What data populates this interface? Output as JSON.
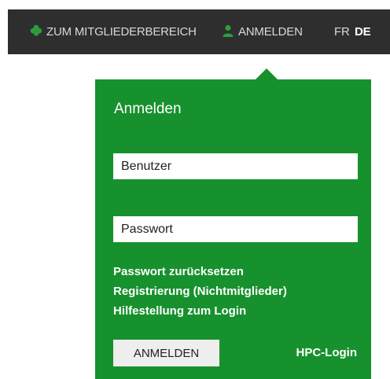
{
  "topbar": {
    "members_label": "ZUM MITGLIEDERBEREICH",
    "members_icon": "clover-icon",
    "login_label": "ANMELDEN",
    "login_icon": "user-icon",
    "lang_fr": "FR",
    "lang_de": "DE",
    "active_language": "DE",
    "icon_color": "#2e9e3a"
  },
  "login_panel": {
    "title": "Anmelden",
    "username_placeholder": "Benutzer",
    "password_placeholder": "Passwort",
    "links": [
      "Passwort zurücksetzen",
      "Registrierung (Nichtmitglieder)",
      "Hilfestellung zum Login"
    ],
    "submit_label": "ANMELDEN",
    "hpc_login_label": "HPC-Login",
    "background_color": "#17912d"
  }
}
